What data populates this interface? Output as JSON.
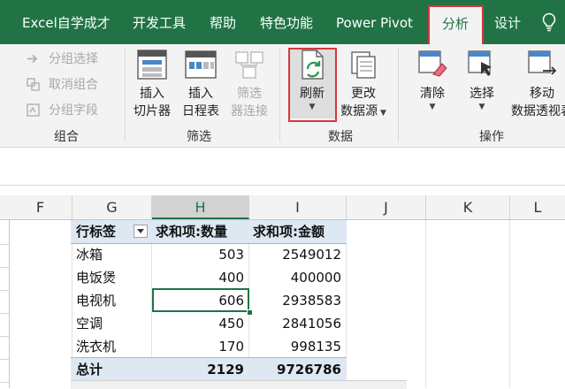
{
  "tabs": [
    {
      "name": "tab-excel-learning",
      "label": "Excel自学成才"
    },
    {
      "name": "tab-developer",
      "label": "开发工具"
    },
    {
      "name": "tab-help",
      "label": "帮助"
    },
    {
      "name": "tab-special-features",
      "label": "特色功能"
    },
    {
      "name": "tab-power-pivot",
      "label": "Power Pivot"
    },
    {
      "name": "tab-analyze",
      "label": "分析"
    },
    {
      "name": "tab-design",
      "label": "设计"
    }
  ],
  "ribbon": {
    "group_group": {
      "label": "组合",
      "buttons": [
        "分组选择",
        "取消组合",
        "分组字段"
      ]
    },
    "group_filter": {
      "label": "筛选",
      "insert_slicer": [
        "插入",
        "切片器"
      ],
      "insert_timeline": [
        "插入",
        "日程表"
      ],
      "filter_connections": [
        "筛选",
        "器连接"
      ]
    },
    "group_data": {
      "label": "数据",
      "refresh": "刷新",
      "change_source": [
        "更改",
        "数据源"
      ]
    },
    "group_actions": {
      "label": "操作",
      "clear": "清除",
      "select": "选择",
      "move": [
        "移动",
        "数据透视表"
      ]
    }
  },
  "columns": [
    "F",
    "G",
    "H",
    "I",
    "J",
    "K",
    "L"
  ],
  "pivot": {
    "headers": [
      "行标签",
      "求和项:数量",
      "求和项:金额"
    ],
    "rows": [
      {
        "label": "冰箱",
        "qty": "503",
        "amount": "2549012"
      },
      {
        "label": "电饭煲",
        "qty": "400",
        "amount": "400000"
      },
      {
        "label": "电视机",
        "qty": "606",
        "amount": "2938583"
      },
      {
        "label": "空调",
        "qty": "450",
        "amount": "2841056"
      },
      {
        "label": "洗衣机",
        "qty": "170",
        "amount": "998135"
      }
    ],
    "total": {
      "label": "总计",
      "qty": "2129",
      "amount": "9726786"
    }
  },
  "colors": {
    "accent": "#217346",
    "highlight": "#d33a3a",
    "pivot_header": "#dde8f3"
  }
}
